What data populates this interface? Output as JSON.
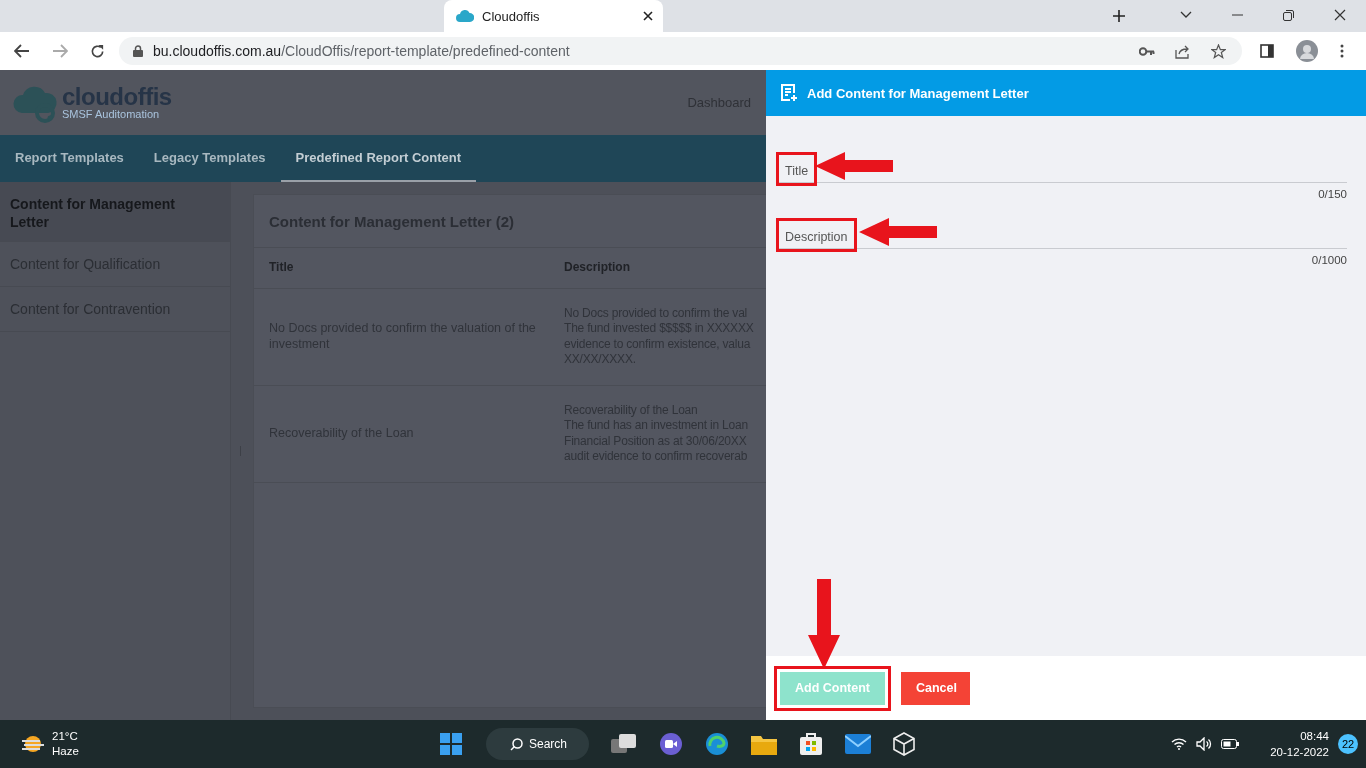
{
  "browser": {
    "tab_title": "Cloudoffis",
    "address": {
      "host": "bu.cloudoffis.com.au",
      "path": "/CloudOffis/report-template/predefined-content"
    }
  },
  "app": {
    "logo": {
      "name": "cloudoffis",
      "tagline": "SMSF Auditomation"
    },
    "header_link": "Dashboard",
    "nav": [
      {
        "label": "Report Templates",
        "selected": false
      },
      {
        "label": "Legacy Templates",
        "selected": false
      },
      {
        "label": "Predefined Report Content",
        "selected": true
      }
    ],
    "sidebar": [
      {
        "label": "Content for Management Letter",
        "selected": true
      },
      {
        "label": "Content for Qualification",
        "selected": false
      },
      {
        "label": "Content for Contravention",
        "selected": false
      }
    ],
    "panel_title": "Content for Management Letter (2)",
    "table": {
      "columns": [
        "Title",
        "Description"
      ],
      "rows": [
        {
          "title": "No Docs provided to confirm the valuation of the investment",
          "description": [
            "No Docs provided to confirm the val",
            "The fund invested $$$$$ in XXXXXX",
            "evidence to confirm existence, valua",
            "XX/XX/XXXX."
          ]
        },
        {
          "title": "Recoverability of the Loan",
          "description": [
            "Recoverability of the Loan",
            "The fund has an investment in Loan",
            "Financial Position as at 30/06/20XX",
            "audit evidence to confirm recoverab"
          ]
        }
      ]
    }
  },
  "drawer": {
    "title": "Add Content for Management Letter",
    "fields": [
      {
        "label": "Title",
        "counter": "0/150",
        "highlighted": true
      },
      {
        "label": "Description",
        "counter": "0/1000",
        "highlighted": true
      }
    ],
    "buttons": [
      {
        "label": "Add Content",
        "kind": "primary",
        "disabled": true,
        "highlighted": true
      },
      {
        "label": "Cancel",
        "kind": "danger",
        "disabled": false,
        "highlighted": false
      }
    ]
  },
  "taskbar": {
    "temperature": "21°C",
    "weather": "Haze",
    "search": "Search",
    "time": "08:44",
    "date": "20-12-2022",
    "notifications": "22"
  }
}
